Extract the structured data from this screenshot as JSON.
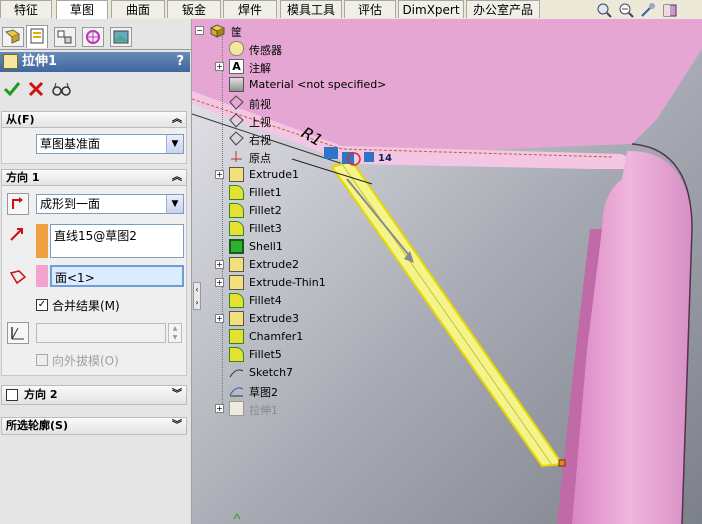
{
  "tabs": [
    "特征",
    "草图",
    "曲面",
    "钣金",
    "焊件",
    "模具工具",
    "评估",
    "DimXpert",
    "办公室产品"
  ],
  "toolbar_icons": [
    "zoom-fit-icon",
    "zoom-area-icon",
    "previous-view-icon",
    "section-view-icon"
  ],
  "property_manager": {
    "title": "拉伸1",
    "help": "?",
    "ok_icon": "checkmark-icon",
    "cancel_icon": "x-icon",
    "preview_icon": "glasses-icon",
    "from": {
      "header": "从(F)",
      "start_condition": "草图基准面"
    },
    "direction1": {
      "header": "方向 1",
      "end_condition": "成形到一面",
      "direction_ref": "直线15@草图2",
      "face_ref": "面<1>",
      "merge_result_label": "合并结果(M)",
      "merge_result_checked": true,
      "draft_value": "",
      "draft_outward_label": "向外拔模(O)",
      "draft_outward_checked": false
    },
    "direction2": {
      "header": "方向 2",
      "checked": false
    },
    "selected_contours": {
      "header": "所选轮廓(S)"
    }
  },
  "tree": {
    "root": "筐",
    "items": [
      {
        "label": "传感器",
        "icon": "sensor-icon",
        "expandable": false
      },
      {
        "label": "注解",
        "icon": "annotation-icon",
        "expandable": true
      },
      {
        "label": "Material <not specified>",
        "icon": "material-icon",
        "expandable": false
      },
      {
        "label": "前视",
        "icon": "plane-icon",
        "expandable": false
      },
      {
        "label": "上视",
        "icon": "plane-icon",
        "expandable": false
      },
      {
        "label": "右视",
        "icon": "plane-icon",
        "expandable": false
      },
      {
        "label": "原点",
        "icon": "origin-icon",
        "expandable": false
      },
      {
        "label": "Extrude1",
        "icon": "extrude-icon",
        "expandable": true
      },
      {
        "label": "Fillet1",
        "icon": "fillet-icon",
        "expandable": false
      },
      {
        "label": "Fillet2",
        "icon": "fillet-icon",
        "expandable": false
      },
      {
        "label": "Fillet3",
        "icon": "fillet-icon",
        "expandable": false
      },
      {
        "label": "Shell1",
        "icon": "shell-icon",
        "expandable": false
      },
      {
        "label": "Extrude2",
        "icon": "extrude-icon",
        "expandable": true
      },
      {
        "label": "Extrude-Thin1",
        "icon": "extrude-icon",
        "expandable": true
      },
      {
        "label": "Fillet4",
        "icon": "fillet-icon",
        "expandable": false
      },
      {
        "label": "Extrude3",
        "icon": "extrude-icon",
        "expandable": true
      },
      {
        "label": "Chamfer1",
        "icon": "chamfer-icon",
        "expandable": false
      },
      {
        "label": "Fillet5",
        "icon": "fillet-icon",
        "expandable": false
      },
      {
        "label": "Sketch7",
        "icon": "sketch-icon",
        "expandable": false
      },
      {
        "label": "草图2",
        "icon": "sketch-icon",
        "expandable": false
      },
      {
        "label": "拉伸1",
        "icon": "extrude-icon",
        "expandable": true,
        "greyed": true
      }
    ]
  },
  "viewport": {
    "dimension_text": "R1",
    "dimension_value": "14",
    "colors": {
      "part": "#e8a0d0",
      "preview": "#f5f58a",
      "edge": "#c0602a",
      "selection": "#2f74c8"
    }
  }
}
